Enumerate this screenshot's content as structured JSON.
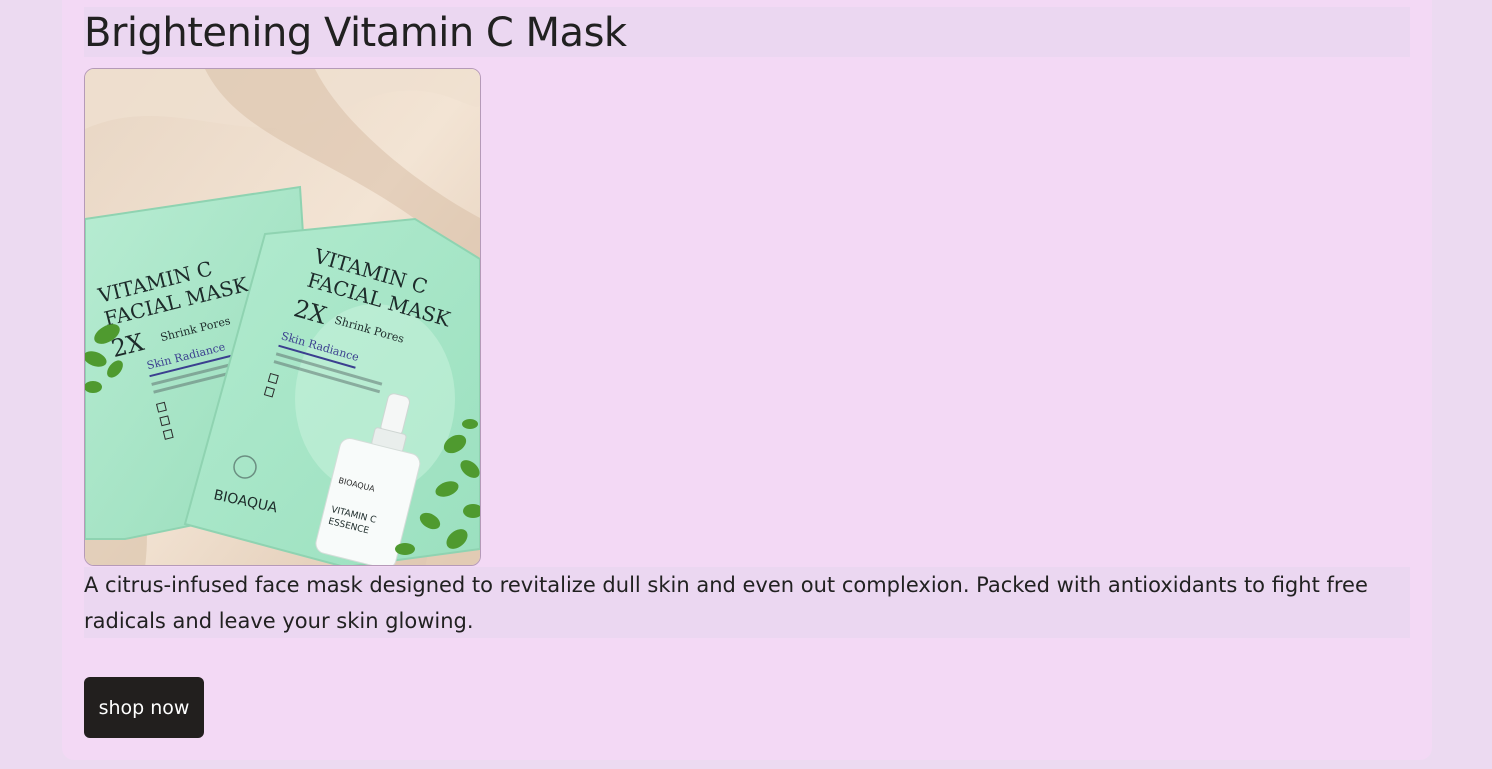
{
  "product": {
    "title": "Brightening Vitamin C Mask",
    "description": "A citrus-infused face mask designed to revitalize dull skin and even out complexion. Packed with antioxidants to fight free radicals and leave your skin glowing.",
    "image_alt": "Vitamin C facial mask packets with serum bottle",
    "image_text": {
      "mask_line1": "VITAMIN C",
      "mask_line2": "FACIAL MASK",
      "mask_badge": "2X",
      "mask_tag": "Shrink Pores",
      "mask_sub": "Skin Radiance",
      "brand": "BIOAQUA",
      "bottle_brand": "BIOAQUA",
      "bottle_line1": "VITAMIN C",
      "bottle_line2": "ESSENCE"
    }
  },
  "actions": {
    "shop_label": "shop now"
  },
  "colors": {
    "page_bg": "#ecdaf1",
    "card_bg": "#f3d9f5",
    "highlight_bg": "#ebd7f1",
    "button_bg": "#221f1e",
    "button_text": "#ffffff",
    "mask_green": "#a7e6c6"
  }
}
